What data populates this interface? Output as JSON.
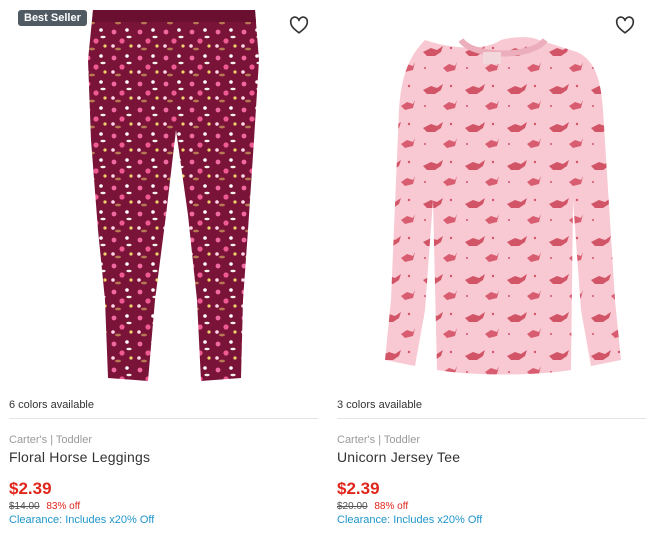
{
  "products": [
    {
      "badge": "Best Seller",
      "colors": "6 colors available",
      "brand": "Carter's | Toddler",
      "title": "Floral Horse Leggings",
      "price": "$2.39",
      "original_price": "$14.00",
      "discount": "83% off",
      "clearance": "Clearance: Includes x20% Off",
      "image": "floral-leggings-image"
    },
    {
      "badge": "",
      "colors": "3 colors available",
      "brand": "Carter's | Toddler",
      "title": "Unicorn Jersey Tee",
      "price": "$2.39",
      "original_price": "$20.00",
      "discount": "88% off",
      "clearance": "Clearance: Includes x20% Off",
      "image": "unicorn-tee-image"
    }
  ],
  "theme": {
    "sale_red": "#e1271d",
    "link_blue": "#2196c8",
    "badge_bg": "#4f5a63"
  }
}
